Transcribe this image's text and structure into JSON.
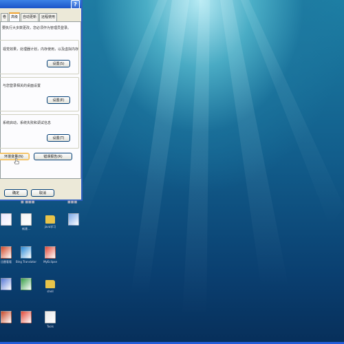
{
  "dialog": {
    "help_glyph": "?",
    "tabs": [
      {
        "label": "卷",
        "state": "inactive"
      },
      {
        "label": "高级",
        "state": "active"
      },
      {
        "label": "自动更新",
        "state": "inactive"
      },
      {
        "label": "远程使用",
        "state": "inactive"
      }
    ],
    "description": "要执行大多数更改，您必须作为管理员登录。",
    "groups": [
      {
        "text": "视觉效果，处理器计划，内存使用，以及虚拟内存",
        "button": "设置(S)"
      },
      {
        "text": "与您登录相关的桌面设置",
        "button": "设置(E)"
      },
      {
        "text": "系统启动，系统失败和调试信息",
        "button": "设置(T)"
      }
    ],
    "bottom_buttons": {
      "env": "环境变量(N)",
      "error": "错误报告(R)"
    },
    "footer_buttons": {
      "ok": "确定",
      "cancel": "取消"
    },
    "status_left": "■ ■■■",
    "status_right": "■■■"
  },
  "desktop_icons": [
    {
      "label": "",
      "icon": "application-icon",
      "color": "#e8e8ff"
    },
    {
      "label": "新建…",
      "icon": "document-icon",
      "color": "#f4f4f4"
    },
    {
      "label": "java学习",
      "icon": "folder-icon",
      "color": "#e8c44a"
    },
    {
      "label": "",
      "icon": "monitor-icon",
      "color": "#7aa8e8"
    },
    {
      "label": "迅雷看看",
      "icon": "media-icon",
      "color": "#d24a2a"
    },
    {
      "label": "Bing Translator",
      "icon": "translate-icon",
      "color": "#2a8ad6"
    },
    {
      "label": "MyEclipse",
      "icon": "pdf-icon",
      "color": "#e24b3a"
    },
    {
      "label": "",
      "icon": "tools-icon",
      "color": "#5a7ad6"
    },
    {
      "label": "",
      "icon": "sheet-icon",
      "color": "#3aa04a"
    },
    {
      "label": "shell",
      "icon": "folder-icon",
      "color": "#e8c44a"
    },
    {
      "label": "",
      "icon": "game-icon",
      "color": "#c84a2a"
    },
    {
      "label": "",
      "icon": "pdf-icon",
      "color": "#e24b3a"
    },
    {
      "label": "Tools",
      "icon": "file-icon",
      "color": "#e8e8e8"
    }
  ]
}
